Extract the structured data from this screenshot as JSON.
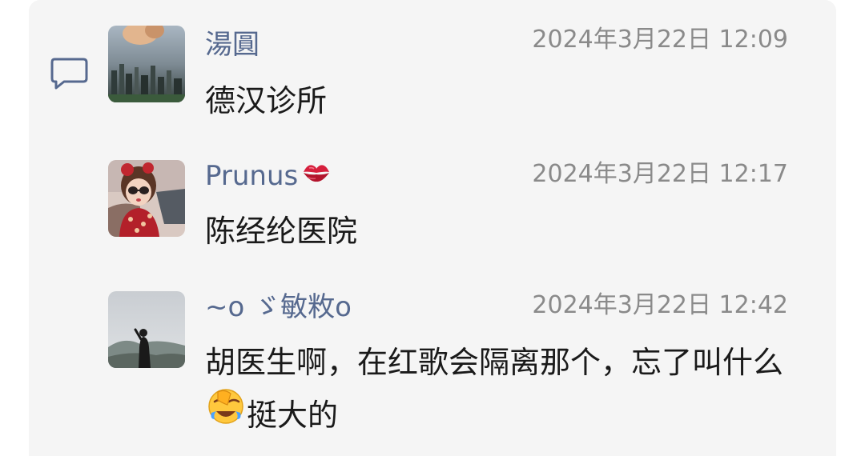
{
  "comments": [
    {
      "user": "湯圓",
      "time": "2024年3月22日 12:09",
      "text": "德汉诊所",
      "avatar_icon": "city-skyline-photo-avatar"
    },
    {
      "user": "Prunus",
      "user_emoji": "kiss-mark-icon",
      "time": "2024年3月22日 12:17",
      "text": "陈经纶医院",
      "avatar_icon": "cartoon-girl-avatar"
    },
    {
      "user": "~o ゞ敏敉o",
      "time": "2024年3月22日 12:42",
      "text_before_emoji": "胡医生啊，在红歌会隔离那个，忘了叫什么",
      "text_emoji": "face-palm-laughing-emoji",
      "text_after_emoji": "挺大的",
      "avatar_icon": "silhouette-landscape-avatar"
    }
  ],
  "colors": {
    "panel_bg": "#f5f5f5",
    "username": "#56698f",
    "timestamp": "#8a8a8a",
    "text": "#1a1a1a"
  },
  "icons": {
    "comment_section": "comment-bubble-icon"
  }
}
